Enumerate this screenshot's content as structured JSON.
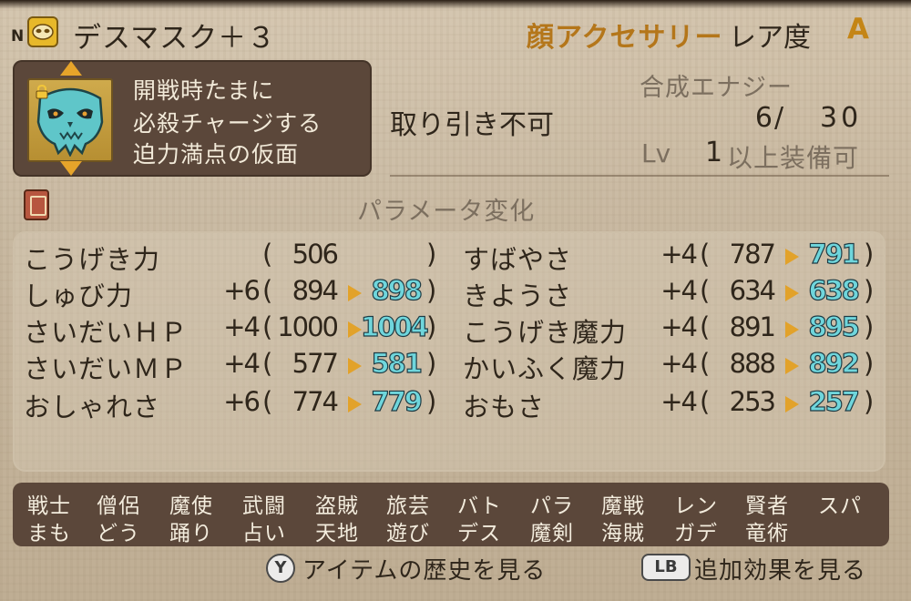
{
  "header": {
    "n_mark": "N",
    "item_name": "デスマスク＋３",
    "category": "顔アクセサリー",
    "rarity_label": "レア度",
    "rarity_value": "A"
  },
  "description": {
    "lines": [
      "開戦時たまに",
      "必殺チャージする",
      "迫力満点の仮面"
    ]
  },
  "info": {
    "tradable": "取り引き不可",
    "energy_label": "合成エナジー",
    "energy_current": "6",
    "energy_slash": "/",
    "energy_max": "30",
    "lv_label": "Lv",
    "lv_value": "1",
    "lv_text": "以上装備可"
  },
  "params": {
    "title": "パラメータ変化",
    "left": [
      {
        "name": "こうげき力",
        "bonus": "",
        "current": "506",
        "new": ""
      },
      {
        "name": "しゅび力",
        "bonus": "+6",
        "current": "894",
        "new": "898"
      },
      {
        "name": "さいだいＨＰ",
        "bonus": "+4",
        "current": "1000",
        "new": "1004"
      },
      {
        "name": "さいだいＭＰ",
        "bonus": "+4",
        "current": "577",
        "new": "581"
      },
      {
        "name": "おしゃれさ",
        "bonus": "+6",
        "current": "774",
        "new": "779"
      }
    ],
    "right": [
      {
        "name": "すばやさ",
        "bonus": "+4",
        "current": "787",
        "new": "791"
      },
      {
        "name": "きようさ",
        "bonus": "+4",
        "current": "634",
        "new": "638"
      },
      {
        "name": "こうげき魔力",
        "bonus": "+4",
        "current": "891",
        "new": "895"
      },
      {
        "name": "かいふく魔力",
        "bonus": "+4",
        "current": "888",
        "new": "892"
      },
      {
        "name": "おもさ",
        "bonus": "+4",
        "current": "253",
        "new": "257"
      }
    ]
  },
  "jobs": {
    "row1": [
      "戦士",
      "僧侶",
      "魔使",
      "武闘",
      "盗賊",
      "旅芸",
      "バト",
      "パラ",
      "魔戦",
      "レン",
      "賢者",
      "スパ"
    ],
    "row2": [
      "まも",
      "どう",
      "踊り",
      "占い",
      "天地",
      "遊び",
      "デス",
      "魔剣",
      "海賊",
      "ガデ",
      "竜術"
    ]
  },
  "footer": {
    "y_button": "Y",
    "history_label": "アイテムの歴史を見る",
    "lb_button": "LB",
    "extra_label": "追加効果を見る"
  },
  "colors": {
    "parchment": "#c7b79f",
    "dark_panel": "#5b473a",
    "category_orange": "#b4761a",
    "new_value_cyan": "#6fd6dc",
    "arrow_orange": "#e2a22a"
  },
  "icons": {
    "item_type": "mask-icon",
    "portrait": "skull-mask-icon",
    "lock": "lock-icon",
    "book": "book-icon"
  }
}
